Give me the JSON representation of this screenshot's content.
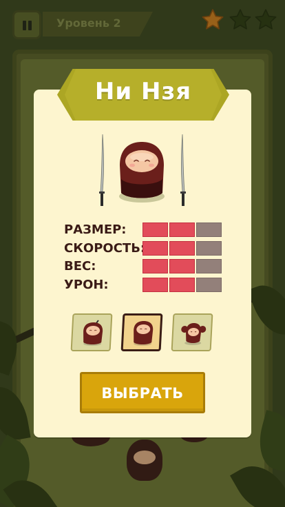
{
  "topbar": {
    "pause_icon": "pause-icon",
    "level_label": "Уровень 2",
    "stars": [
      {
        "state": "earned",
        "color": "#c4781f"
      },
      {
        "state": "empty",
        "color": "#2c3a14"
      },
      {
        "state": "empty",
        "color": "#2c3a14"
      }
    ]
  },
  "character": {
    "name": "Ни Нзя",
    "weapon_icon": "katana-icon"
  },
  "stats": [
    {
      "label": "РАЗМЕР:",
      "value": 2,
      "max": 3
    },
    {
      "label": "СКОРОСТЬ:",
      "value": 2,
      "max": 3
    },
    {
      "label": "ВЕС:",
      "value": 2,
      "max": 3
    },
    {
      "label": "УРОН:",
      "value": 2,
      "max": 3
    }
  ],
  "character_options": [
    {
      "name": "ninja-with-sword",
      "selected": false
    },
    {
      "name": "ni-nzya",
      "selected": true
    },
    {
      "name": "monkey-ninja",
      "selected": false
    }
  ],
  "choose_button": {
    "label": "ВЫБРАТЬ"
  },
  "colors": {
    "card_bg": "#fdf5cf",
    "banner": "#b6af2a",
    "stat_on": "#e24c5a",
    "stat_off": "#93807a",
    "button": "#d9a50c"
  }
}
